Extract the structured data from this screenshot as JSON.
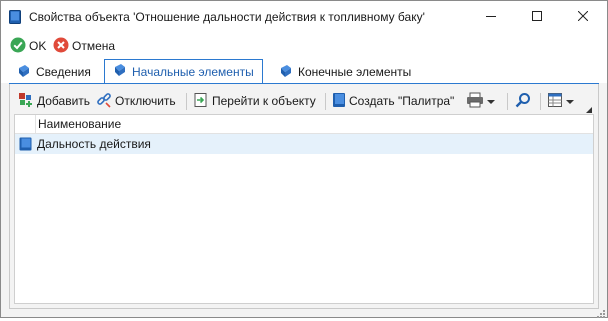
{
  "window": {
    "title": "Свойства объекта 'Отношение дальности действия к топливному баку'",
    "controls": [
      "minimize-icon",
      "maximize-icon",
      "close-icon"
    ]
  },
  "actions": {
    "ok_label": "OK",
    "cancel_label": "Отмена"
  },
  "tabs": [
    {
      "label": "Сведения",
      "active": false
    },
    {
      "label": "Начальные элементы",
      "active": true
    },
    {
      "label": "Конечные элементы",
      "active": false
    }
  ],
  "toolbar": {
    "add_label": "Добавить",
    "disconnect_label": "Отключить",
    "goto_label": "Перейти к объекту",
    "create_palette_label": "Создать \"Палитра\""
  },
  "grid": {
    "column_header": "Наименование",
    "rows": [
      {
        "name": "Дальность действия",
        "selected": true
      }
    ]
  },
  "colors": {
    "accent": "#2b79d0",
    "ok_green": "#3aa655",
    "cancel_red": "#e04a3a",
    "selected_row": "#e5f1fb"
  }
}
